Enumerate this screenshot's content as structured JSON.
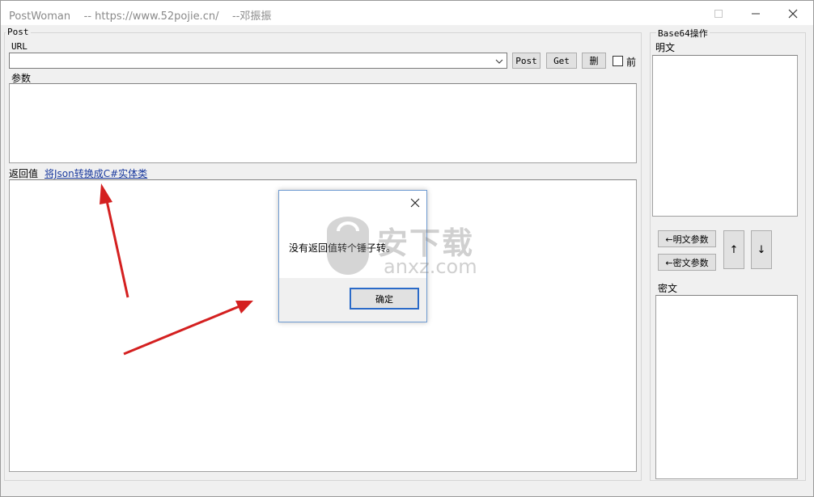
{
  "window": {
    "title": "PostWoman    -- https://www.52pojie.cn/    --邓振振"
  },
  "post_group": {
    "title": "Post",
    "url_label": "URL",
    "url_value": "",
    "post_button": "Post",
    "get_button": "Get",
    "delete_button": "删",
    "checkbox_label": "前",
    "checkbox_checked": false,
    "params_label": "参数",
    "params_value": ""
  },
  "response": {
    "label": "返回值",
    "link": "将Json转换成C#实体类",
    "value": ""
  },
  "base64_group": {
    "title": "Base64操作",
    "plain_label": "明文",
    "plain_value": "",
    "plain_param_button": "←明文参数",
    "cipher_param_button": "←密文参数",
    "cipher_label": "密文",
    "cipher_value": "",
    "up_button": "↑",
    "down_button": "↓"
  },
  "dialog": {
    "message": "没有返回值转个锤子转。",
    "ok_button": "确定"
  },
  "watermark": {
    "text": "安下载",
    "subtext": "anxz.com"
  },
  "colors": {
    "annotation_arrow": "#d42020",
    "dialog_border": "#6f9bd1",
    "link": "#1a3a9e"
  }
}
